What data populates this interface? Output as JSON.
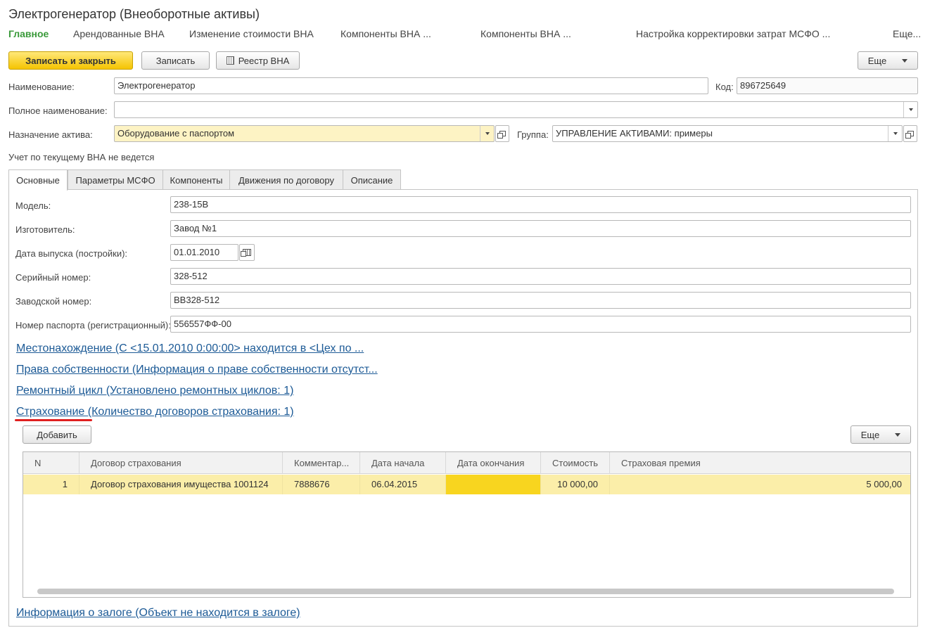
{
  "window": {
    "title": "Электрогенератор (Внеоборотные активы)"
  },
  "nav": {
    "items": [
      "Главное",
      "Арендованные ВНА",
      "Изменение стоимости ВНА",
      "Компоненты ВНА ...",
      "Компоненты ВНА ...",
      "Настройка корректировки затрат МСФО ...",
      "Еще..."
    ]
  },
  "toolbar": {
    "save_close": "Записать и закрыть",
    "save": "Записать",
    "registry": "Реестр ВНА",
    "more": "Еще"
  },
  "form": {
    "name_label": "Наименование:",
    "name_value": "Электрогенератор",
    "code_label": "Код:",
    "code_value": "896725649",
    "fullname_label": "Полное наименование:",
    "fullname_value": "",
    "purpose_label": "Назначение актива:",
    "purpose_value": "Оборудование с паспортом",
    "group_label": "Группа:",
    "group_value": "УПРАВЛЕНИЕ АКТИВАМИ: примеры",
    "accounting_note": "Учет по текущему ВНА не ведется"
  },
  "tabs": [
    "Основные",
    "Параметры МСФО",
    "Компоненты",
    "Движения по договору",
    "Описание"
  ],
  "main": {
    "model_label": "Модель:",
    "model_value": "238-15В",
    "maker_label": "Изготовитель:",
    "maker_value": "Завод №1",
    "date_label": "Дата выпуска (постройки):",
    "date_value": "01.01.2010",
    "serial_label": "Серийный номер:",
    "serial_value": "328-512",
    "factory_label": "Заводской номер:",
    "factory_value": "ВВ328-512",
    "passport_label": "Номер паспорта (регистрационный):",
    "passport_value": "556557ФФ-00"
  },
  "links": {
    "location": "Местонахождение (С <15.01.2010 0:00:00> находится в <Цех по ...",
    "ownership": "Права собственности (Информация о праве собственности отсутст...",
    "repair": "Ремонтный цикл (Установлено ремонтных циклов: 1)",
    "insurance": "Страхование (Количество договоров страхования: 1)",
    "pledge": "Информация о залоге (Объект не находится в залоге)"
  },
  "insurance_table": {
    "add_button": "Добавить",
    "more_button": "Еще",
    "columns": [
      "N",
      "Договор страхования",
      "Комментар...",
      "Дата начала",
      "Дата окончания",
      "Стоимость",
      "Страховая премия"
    ],
    "rows": [
      {
        "n": "1",
        "contract": "Договор страхования имущества 1001124",
        "comment": "7888676",
        "start": "06.04.2015",
        "end": "",
        "cost": "10 000,00",
        "premium": "5 000,00"
      }
    ]
  },
  "colors": {
    "accent_green": "#3a9a3a",
    "primary_button": "#f5c400",
    "link": "#1c5a96",
    "row_highlight": "#fbeea9",
    "cell_selected": "#f8d51f",
    "annotation_red": "#e02020"
  }
}
